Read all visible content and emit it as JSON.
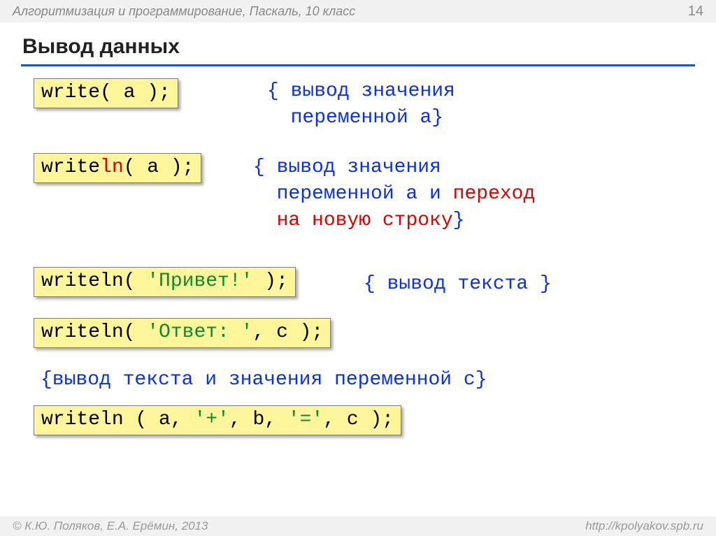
{
  "header": {
    "breadcrumb": "Алгоритмизация и программирование, Паскаль, 10 класс",
    "page_number": "14"
  },
  "title": "Вывод данных",
  "rows": {
    "r1": {
      "code_plain": "write( a );",
      "comment_open": "{ ",
      "comment_l1": "вывод значения",
      "comment_l2": "переменной a",
      "comment_close": "}"
    },
    "r2": {
      "code_pre": "write",
      "code_ln": "ln",
      "code_post": "( a );",
      "comment_open": "{ ",
      "comment_l1": "вывод значения",
      "comment_l2a": "переменной a и ",
      "comment_l2b_red": "переход",
      "comment_l3_red": "на новую строку",
      "comment_close": "}"
    },
    "r3": {
      "code_pre": "writeln( ",
      "code_lit": "'Привет!'",
      "code_post": " );",
      "comment": "{ вывод текста }"
    },
    "r4": {
      "code_pre": "writeln( ",
      "code_lit": "'Ответ: '",
      "code_post": ", c );"
    },
    "r5": {
      "comment": "{вывод текста и значения переменной c}"
    },
    "r6": {
      "p1": "writeln ( a, ",
      "lit1": "'+'",
      "p2": ", b, ",
      "lit2": "'='",
      "p3": ", c );"
    }
  },
  "footer": {
    "copyright": "© К.Ю. Поляков, Е.А. Ерёмин, 2013",
    "url": "http://kpolyakov.spb.ru"
  }
}
